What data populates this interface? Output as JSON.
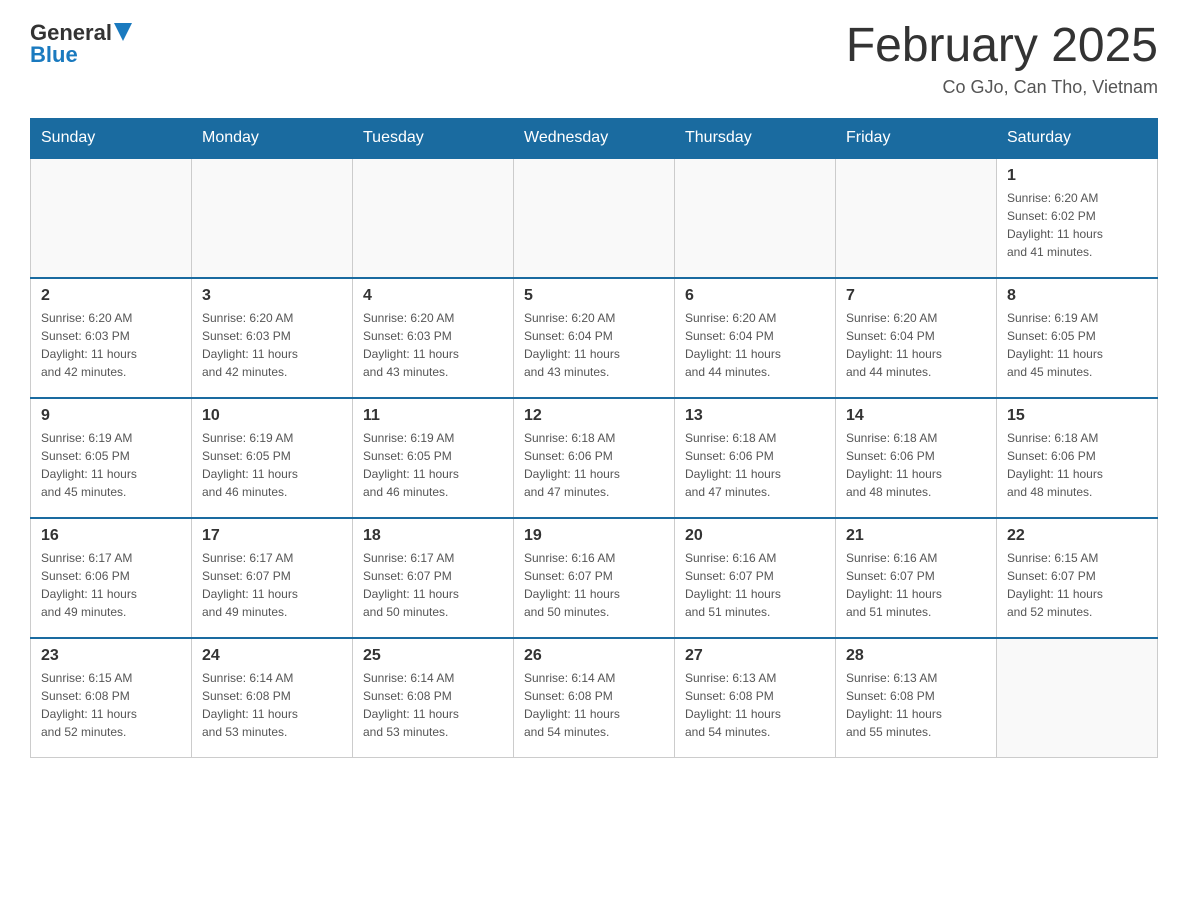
{
  "header": {
    "logo_text_general": "General",
    "logo_text_blue": "Blue",
    "title": "February 2025",
    "subtitle": "Co GJo, Can Tho, Vietnam"
  },
  "days_of_week": [
    "Sunday",
    "Monday",
    "Tuesday",
    "Wednesday",
    "Thursday",
    "Friday",
    "Saturday"
  ],
  "weeks": [
    [
      {
        "day": "",
        "info": ""
      },
      {
        "day": "",
        "info": ""
      },
      {
        "day": "",
        "info": ""
      },
      {
        "day": "",
        "info": ""
      },
      {
        "day": "",
        "info": ""
      },
      {
        "day": "",
        "info": ""
      },
      {
        "day": "1",
        "info": "Sunrise: 6:20 AM\nSunset: 6:02 PM\nDaylight: 11 hours\nand 41 minutes."
      }
    ],
    [
      {
        "day": "2",
        "info": "Sunrise: 6:20 AM\nSunset: 6:03 PM\nDaylight: 11 hours\nand 42 minutes."
      },
      {
        "day": "3",
        "info": "Sunrise: 6:20 AM\nSunset: 6:03 PM\nDaylight: 11 hours\nand 42 minutes."
      },
      {
        "day": "4",
        "info": "Sunrise: 6:20 AM\nSunset: 6:03 PM\nDaylight: 11 hours\nand 43 minutes."
      },
      {
        "day": "5",
        "info": "Sunrise: 6:20 AM\nSunset: 6:04 PM\nDaylight: 11 hours\nand 43 minutes."
      },
      {
        "day": "6",
        "info": "Sunrise: 6:20 AM\nSunset: 6:04 PM\nDaylight: 11 hours\nand 44 minutes."
      },
      {
        "day": "7",
        "info": "Sunrise: 6:20 AM\nSunset: 6:04 PM\nDaylight: 11 hours\nand 44 minutes."
      },
      {
        "day": "8",
        "info": "Sunrise: 6:19 AM\nSunset: 6:05 PM\nDaylight: 11 hours\nand 45 minutes."
      }
    ],
    [
      {
        "day": "9",
        "info": "Sunrise: 6:19 AM\nSunset: 6:05 PM\nDaylight: 11 hours\nand 45 minutes."
      },
      {
        "day": "10",
        "info": "Sunrise: 6:19 AM\nSunset: 6:05 PM\nDaylight: 11 hours\nand 46 minutes."
      },
      {
        "day": "11",
        "info": "Sunrise: 6:19 AM\nSunset: 6:05 PM\nDaylight: 11 hours\nand 46 minutes."
      },
      {
        "day": "12",
        "info": "Sunrise: 6:18 AM\nSunset: 6:06 PM\nDaylight: 11 hours\nand 47 minutes."
      },
      {
        "day": "13",
        "info": "Sunrise: 6:18 AM\nSunset: 6:06 PM\nDaylight: 11 hours\nand 47 minutes."
      },
      {
        "day": "14",
        "info": "Sunrise: 6:18 AM\nSunset: 6:06 PM\nDaylight: 11 hours\nand 48 minutes."
      },
      {
        "day": "15",
        "info": "Sunrise: 6:18 AM\nSunset: 6:06 PM\nDaylight: 11 hours\nand 48 minutes."
      }
    ],
    [
      {
        "day": "16",
        "info": "Sunrise: 6:17 AM\nSunset: 6:06 PM\nDaylight: 11 hours\nand 49 minutes."
      },
      {
        "day": "17",
        "info": "Sunrise: 6:17 AM\nSunset: 6:07 PM\nDaylight: 11 hours\nand 49 minutes."
      },
      {
        "day": "18",
        "info": "Sunrise: 6:17 AM\nSunset: 6:07 PM\nDaylight: 11 hours\nand 50 minutes."
      },
      {
        "day": "19",
        "info": "Sunrise: 6:16 AM\nSunset: 6:07 PM\nDaylight: 11 hours\nand 50 minutes."
      },
      {
        "day": "20",
        "info": "Sunrise: 6:16 AM\nSunset: 6:07 PM\nDaylight: 11 hours\nand 51 minutes."
      },
      {
        "day": "21",
        "info": "Sunrise: 6:16 AM\nSunset: 6:07 PM\nDaylight: 11 hours\nand 51 minutes."
      },
      {
        "day": "22",
        "info": "Sunrise: 6:15 AM\nSunset: 6:07 PM\nDaylight: 11 hours\nand 52 minutes."
      }
    ],
    [
      {
        "day": "23",
        "info": "Sunrise: 6:15 AM\nSunset: 6:08 PM\nDaylight: 11 hours\nand 52 minutes."
      },
      {
        "day": "24",
        "info": "Sunrise: 6:14 AM\nSunset: 6:08 PM\nDaylight: 11 hours\nand 53 minutes."
      },
      {
        "day": "25",
        "info": "Sunrise: 6:14 AM\nSunset: 6:08 PM\nDaylight: 11 hours\nand 53 minutes."
      },
      {
        "day": "26",
        "info": "Sunrise: 6:14 AM\nSunset: 6:08 PM\nDaylight: 11 hours\nand 54 minutes."
      },
      {
        "day": "27",
        "info": "Sunrise: 6:13 AM\nSunset: 6:08 PM\nDaylight: 11 hours\nand 54 minutes."
      },
      {
        "day": "28",
        "info": "Sunrise: 6:13 AM\nSunset: 6:08 PM\nDaylight: 11 hours\nand 55 minutes."
      },
      {
        "day": "",
        "info": ""
      }
    ]
  ]
}
